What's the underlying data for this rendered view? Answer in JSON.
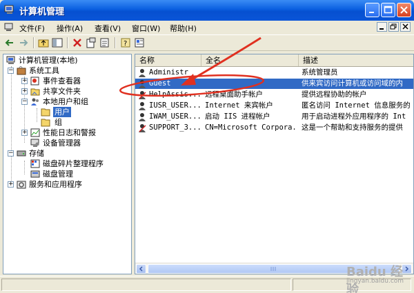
{
  "window": {
    "title": "计算机管理"
  },
  "menu": {
    "items": [
      "文件(F)",
      "操作(A)",
      "查看(V)",
      "窗口(W)",
      "帮助(H)"
    ]
  },
  "tree": {
    "root": "计算机管理(本地)",
    "system_tools": "系统工具",
    "event_viewer": "事件查看器",
    "shared_folders": "共享文件夹",
    "local_users_groups": "本地用户和组",
    "users": "用户",
    "groups": "组",
    "perf_logs": "性能日志和警报",
    "device_manager": "设备管理器",
    "storage": "存储",
    "defrag": "磁盘碎片整理程序",
    "disk_mgmt": "磁盘管理",
    "services_apps": "服务和应用程序"
  },
  "list": {
    "columns": [
      "名称",
      "全名",
      "描述"
    ],
    "rows": [
      {
        "name": "Administr",
        "full": "",
        "desc": "系统管理员"
      },
      {
        "name": "Guest",
        "full": "",
        "desc": "供来宾访问计算机或访问域的内"
      },
      {
        "name": "HelpAssis...",
        "full": "远程桌面助手帐户",
        "desc": "提供远程协助的帐户"
      },
      {
        "name": "IUSR_USER...",
        "full": "Internet 来宾帐户",
        "desc": "匿名访问 Internet 信息服务的"
      },
      {
        "name": "IWAM_USER...",
        "full": "启动 IIS 进程帐户",
        "desc": "用于启动进程外应用程序的 Int"
      },
      {
        "name": "SUPPORT_3...",
        "full": "CN=Microsoft Corpora...",
        "desc": "这是一个帮助和支持服务的提供"
      }
    ]
  },
  "watermark": {
    "brand": "Baidu 经验",
    "url": "jingyan.baidu.com"
  },
  "colors": {
    "title_bar": "#0a5fe0",
    "selection": "#316ac5",
    "annotation": "#e03020"
  }
}
